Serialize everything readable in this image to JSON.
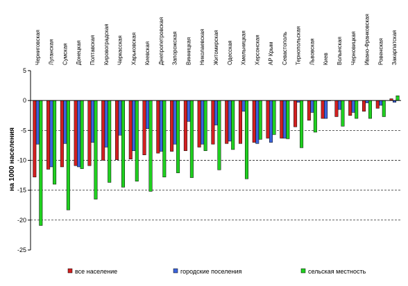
{
  "chart_data": {
    "type": "bar",
    "ylabel": "на 1000 населения",
    "ylim": [
      -25,
      5
    ],
    "yticks": [
      5,
      0,
      -5,
      -10,
      -15,
      -20,
      -25
    ],
    "grid": "dashed horizontal",
    "legend_position": "bottom",
    "categories": [
      "Черниговская",
      "Луганская",
      "Сумская",
      "Донецкая",
      "Полтавская",
      "Кировоградская",
      "Черкасская",
      "Харьковская",
      "Киевская",
      "Днепропетровская",
      "Запорожская",
      "Винницкая",
      "Николаевская",
      "Житомирская",
      "Одесская",
      "Хмельницкая",
      "Херсонская",
      "АР Крым",
      "Севастополь",
      "Тернопольская",
      "Львовская",
      "Киев",
      "Волынская",
      "Черновицкая",
      "Ивано-Франковская",
      "Ровенская",
      "Закарпатская"
    ],
    "series": [
      {
        "name": "все население",
        "color": "#d22020",
        "values": [
          -12.8,
          -11.5,
          -11.1,
          -10.9,
          -10.9,
          -10.0,
          -9.9,
          -9.8,
          -9.1,
          -8.8,
          -8.5,
          -8.4,
          -7.8,
          -7.3,
          -7.2,
          -7.2,
          -7.0,
          -6.3,
          -6.3,
          -4.4,
          -3.3,
          -3.0,
          -2.7,
          -2.5,
          -1.8,
          -1.3,
          0.3
        ]
      },
      {
        "name": "городские поселения",
        "color": "#3c64dc",
        "values": [
          -7.3,
          -11.1,
          -7.2,
          -11.1,
          -7.0,
          -7.8,
          -5.8,
          -8.4,
          -4.7,
          -8.5,
          -7.3,
          -3.5,
          -7.3,
          -4.1,
          -6.8,
          -1.8,
          -7.2,
          -7.0,
          -6.3,
          -0.3,
          -2.0,
          -3.0,
          -1.5,
          -2.0,
          -0.4,
          -0.8,
          -0.3
        ]
      },
      {
        "name": "сельская местность",
        "color": "#20d020",
        "values": [
          -20.9,
          -14.0,
          -18.3,
          -11.4,
          -16.5,
          -13.7,
          -14.5,
          -13.5,
          -15.2,
          -12.8,
          -12.1,
          -12.9,
          -8.4,
          -11.6,
          -8.2,
          -13.1,
          -6.5,
          -5.7,
          -6.4,
          -7.9,
          -5.3,
          0,
          -4.3,
          -3.0,
          -3.0,
          -2.7,
          0.8
        ]
      }
    ]
  }
}
